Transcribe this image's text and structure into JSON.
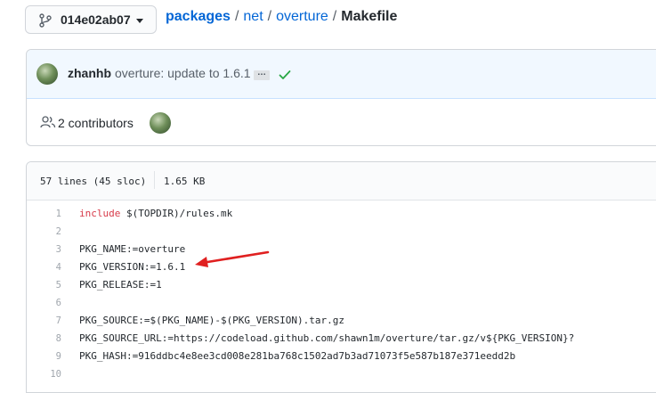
{
  "branch": {
    "label": "014e02ab07"
  },
  "breadcrumb": {
    "repo": "packages",
    "path": [
      "net",
      "overture"
    ],
    "file": "Makefile",
    "separator": "/"
  },
  "commit": {
    "author": "zhanhb",
    "message": "overture: update to 1.6.1",
    "ellipsis": "…",
    "status": "success"
  },
  "contributors": {
    "label": "2 contributors"
  },
  "file": {
    "lines_info": "57 lines (45 sloc)",
    "size": "1.65 KB"
  },
  "code_lines": [
    {
      "n": "1",
      "kw": "include",
      "text": " $(TOPDIR)/rules.mk"
    },
    {
      "n": "2",
      "kw": "",
      "text": ""
    },
    {
      "n": "3",
      "kw": "",
      "text": "PKG_NAME:=overture"
    },
    {
      "n": "4",
      "kw": "",
      "text": "PKG_VERSION:=1.6.1"
    },
    {
      "n": "5",
      "kw": "",
      "text": "PKG_RELEASE:=1"
    },
    {
      "n": "6",
      "kw": "",
      "text": ""
    },
    {
      "n": "7",
      "kw": "",
      "text": "PKG_SOURCE:=$(PKG_NAME)-$(PKG_VERSION).tar.gz"
    },
    {
      "n": "8",
      "kw": "",
      "text": "PKG_SOURCE_URL:=https://codeload.github.com/shawn1m/overture/tar.gz/v${PKG_VERSION}?"
    },
    {
      "n": "9",
      "kw": "",
      "text": "PKG_HASH:=916ddbc4e8ee3cd008e281ba768c1502ad7b3ad71073f5e587b187e371eedd2b"
    },
    {
      "n": "10",
      "kw": "",
      "text": ""
    }
  ],
  "colors": {
    "link": "#0366d6",
    "keyword": "#d73a49",
    "check": "#28a745",
    "annotation_arrow": "#e02020"
  },
  "icons": [
    "git-branch-icon",
    "chevron-down-icon",
    "check-icon",
    "people-icon",
    "red-arrow-annotation"
  ]
}
